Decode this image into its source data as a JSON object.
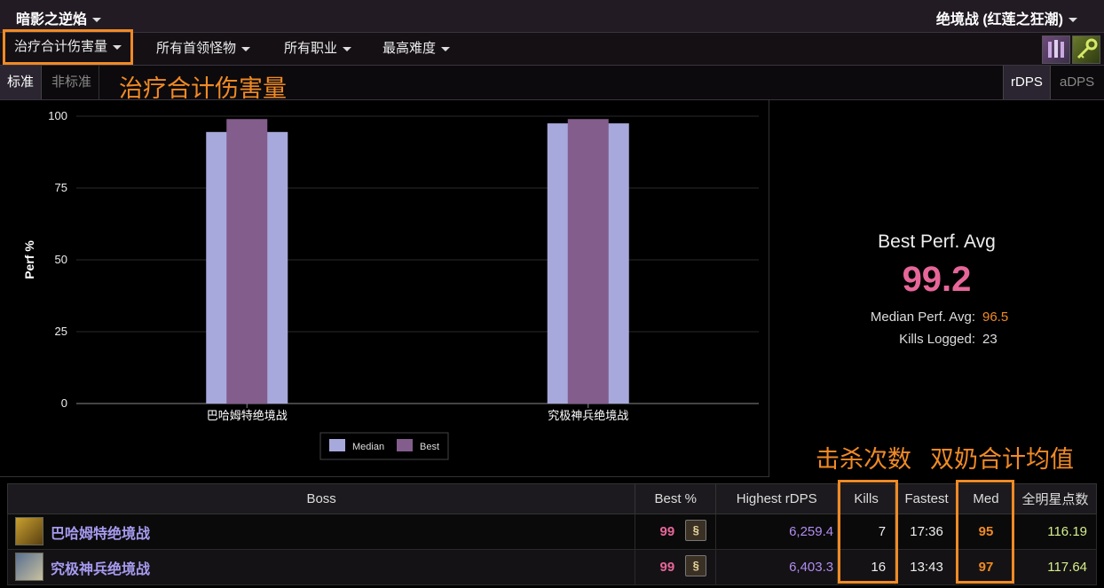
{
  "header": {
    "realm": "暗影之逆焰",
    "raid": "绝境战 (红莲之狂潮)"
  },
  "menu": {
    "metric": "治疗合计伤害量",
    "boss": "所有首领怪物",
    "job": "所有职业",
    "difficulty": "最高难度"
  },
  "filter": {
    "tab_standard": "标准",
    "tab_nonstandard": "非标准",
    "heading": "治疗合计伤害量",
    "rdps": "rDPS",
    "adps": "aDPS"
  },
  "chart_data": {
    "type": "bar",
    "ylabel": "Perf %",
    "ylim": [
      0,
      100
    ],
    "yticks": [
      "0",
      "25",
      "50",
      "75",
      "100"
    ],
    "categories": [
      "巴哈姆特绝境战",
      "究极神兵绝境战"
    ],
    "series": [
      {
        "name": "Median",
        "color": "#a7a9dc",
        "values": [
          94.5,
          97.5
        ]
      },
      {
        "name": "Best",
        "color": "#835d8c",
        "values": [
          99,
          99
        ]
      }
    ]
  },
  "summary": {
    "label": "Best Perf. Avg",
    "value": "99.2",
    "median_label": "Median Perf. Avg:",
    "median_value": "96.5",
    "kills_label": "Kills Logged:",
    "kills_value": "23"
  },
  "annotations": {
    "kills": "击杀次数",
    "med": "双奶合计均值"
  },
  "table": {
    "headers": [
      "Boss",
      "Best %",
      "Highest rDPS",
      "Kills",
      "Fastest",
      "Med",
      "全明星点数"
    ],
    "rows": [
      {
        "boss": "巴哈姆特绝境战",
        "best": "99",
        "highest": "6,259.4",
        "kills": "7",
        "fastest": "17:36",
        "med": "95",
        "allstar": "116.19"
      },
      {
        "boss": "究极神兵绝境战",
        "best": "99",
        "highest": "6,403.3",
        "kills": "16",
        "fastest": "13:43",
        "med": "97",
        "allstar": "117.64"
      }
    ]
  }
}
